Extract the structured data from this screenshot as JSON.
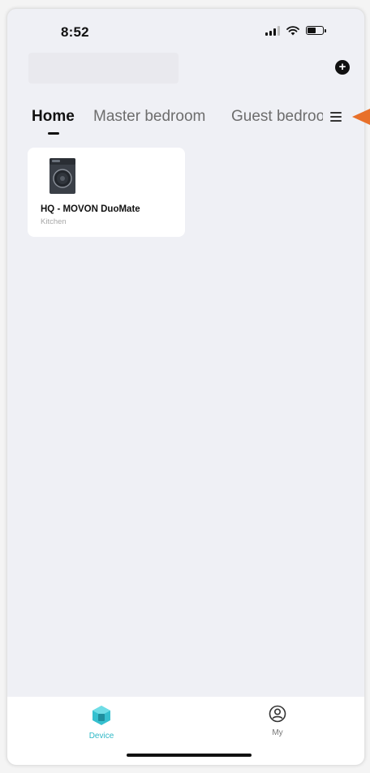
{
  "status_bar": {
    "time": "8:52"
  },
  "header": {
    "add_icon": "plus-circle-icon"
  },
  "tabs": [
    {
      "label": "Home",
      "active": true
    },
    {
      "label": "Master bedroom",
      "active": false
    },
    {
      "label": "Guest bedroom",
      "active": false
    }
  ],
  "menu_icon": "hamburger-menu-icon",
  "devices": [
    {
      "name": "HQ  - MOVON DuoMate",
      "room": "Kitchen",
      "icon": "washing-machine-icon"
    }
  ],
  "bottom_nav": {
    "items": [
      {
        "label": "Device",
        "icon": "device-cube-icon",
        "active": true
      },
      {
        "label": "My",
        "icon": "user-circle-icon",
        "active": false
      }
    ]
  },
  "colors": {
    "background": "#eff0f5",
    "accent": "#2fb8c6",
    "annotation_arrow": "#e8702a"
  }
}
